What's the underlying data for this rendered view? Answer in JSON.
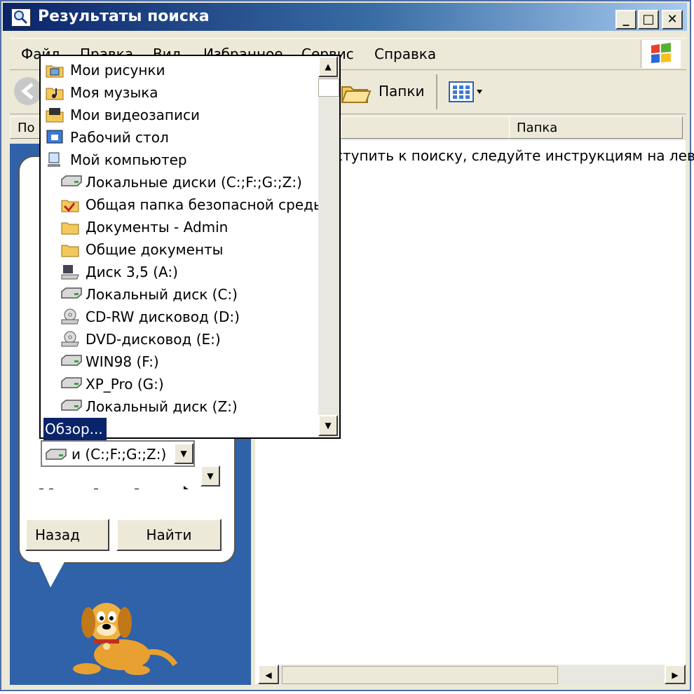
{
  "window": {
    "title": "Результаты поиска",
    "controls": {
      "minimize": "_",
      "maximize": "□",
      "close": "✕"
    }
  },
  "menu": [
    "Файл",
    "Правка",
    "Вид",
    "Избранное",
    "Сервис",
    "Справка"
  ],
  "toolbar": {
    "folders_label": "Папки"
  },
  "columns": {
    "name_partial": "По",
    "folder": "Папка"
  },
  "results": {
    "message": "ступить к поиску, следуйте инструкциям на лев"
  },
  "search_pane": {
    "combo_value": "и (C:;F:;G:;Z:)",
    "back_button": "Назад",
    "find_button": "Найти"
  },
  "dropdown": {
    "items": [
      {
        "label": "Мои рисунки",
        "icon": "pictures-folder-icon",
        "indent": 0
      },
      {
        "label": "Моя музыка",
        "icon": "music-folder-icon",
        "indent": 0
      },
      {
        "label": "Мои видеозаписи",
        "icon": "video-folder-icon",
        "indent": 0
      },
      {
        "label": "Рабочий стол",
        "icon": "desktop-icon",
        "indent": 0
      },
      {
        "label": "Мой компьютер",
        "icon": "computer-icon",
        "indent": 0
      },
      {
        "label": "Локальные диски (C:;F:;G:;Z:)",
        "icon": "drive-icon",
        "indent": 1
      },
      {
        "label": "Общая папка безопасной среды",
        "icon": "shared-folder-icon",
        "indent": 1
      },
      {
        "label": "Документы - Admin",
        "icon": "folder-icon",
        "indent": 1
      },
      {
        "label": "Общие документы",
        "icon": "folder-icon",
        "indent": 1
      },
      {
        "label": "Диск 3,5 (A:)",
        "icon": "floppy-icon",
        "indent": 1
      },
      {
        "label": "Локальный диск (C:)",
        "icon": "drive-icon",
        "indent": 1
      },
      {
        "label": "CD-RW дисковод (D:)",
        "icon": "cd-drive-icon",
        "indent": 1
      },
      {
        "label": "DVD-дисковод (E:)",
        "icon": "cd-drive-icon",
        "indent": 1
      },
      {
        "label": "WIN98 (F:)",
        "icon": "drive-icon",
        "indent": 1
      },
      {
        "label": "XP_Pro (G:)",
        "icon": "drive-icon",
        "indent": 1
      },
      {
        "label": "Локальный диск (Z:)",
        "icon": "drive-icon",
        "indent": 1
      },
      {
        "label": "Обзор...",
        "icon": "",
        "indent": 0,
        "selected": true
      }
    ]
  },
  "colors": {
    "title_start": "#0a246a",
    "title_end": "#a6caf0",
    "assistant_pane": "#2f62a8",
    "selection": "#0a246a",
    "chrome": "#ece9d8"
  }
}
